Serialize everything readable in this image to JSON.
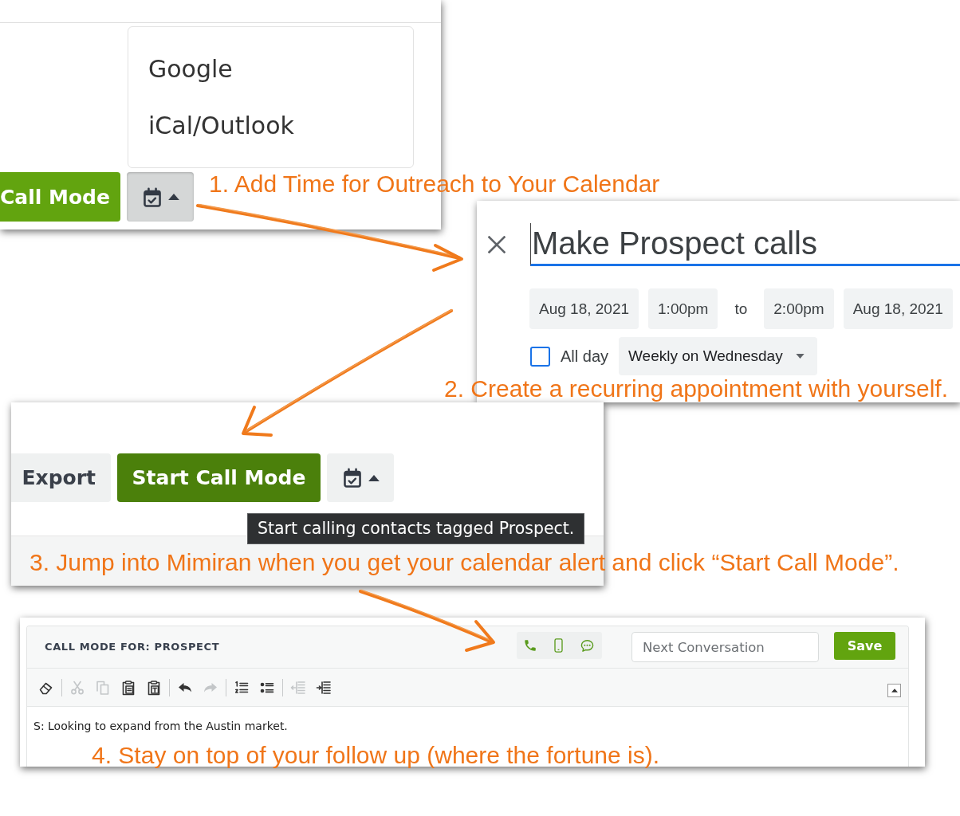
{
  "calendar_menu": {
    "menu_items": [
      {
        "label": "Google"
      },
      {
        "label": "iCal/Outlook"
      }
    ],
    "call_mode_button": {
      "label": "Call Mode",
      "hovered": false
    },
    "calendar_button": {
      "expanded": true
    },
    "caption": "1. Add Time for Outreach to Your Calendar"
  },
  "event_editor": {
    "title": {
      "value": "Make Prospect calls"
    },
    "start_date": "Aug 18, 2021",
    "start_time": "1:00pm",
    "range_separator": "to",
    "end_time": "2:00pm",
    "end_date": "Aug 18, 2021",
    "all_day": {
      "label": "All day",
      "checked": false
    },
    "recurrence": "Weekly on Wednesday",
    "caption": "2. Create a recurring appointment with yourself."
  },
  "call_mode_toolbar": {
    "export_button": "Export",
    "start_button": {
      "label": "Start Call Mode",
      "hovered": true
    },
    "calendar_button": {
      "expanded": false
    },
    "tooltip": "Start calling contacts tagged Prospect.",
    "caption": "3. Jump into Mimiran when you get your calendar alert and click “Start Call Mode”."
  },
  "call_mode_editor": {
    "heading": "CALL MODE FOR: PROSPECT",
    "next_conversation": {
      "placeholder": "Next Conversation"
    },
    "save_button": "Save",
    "toolbar": [
      {
        "tools": [
          {
            "disabled": false
          }
        ]
      },
      {
        "tools": [
          {
            "disabled": true
          },
          {
            "disabled": true
          },
          {
            "disabled": false
          },
          {
            "disabled": false
          }
        ]
      },
      {
        "tools": [
          {
            "disabled": false
          },
          {
            "disabled": true
          }
        ]
      },
      {
        "tools": [
          {
            "disabled": false
          },
          {
            "disabled": false
          }
        ]
      },
      {
        "tools": [
          {
            "disabled": true
          },
          {
            "disabled": false
          }
        ]
      }
    ],
    "body": "S: Looking to expand from the Austin market.",
    "caption": "4. Stay on top of your follow up (where the fortune is)."
  }
}
